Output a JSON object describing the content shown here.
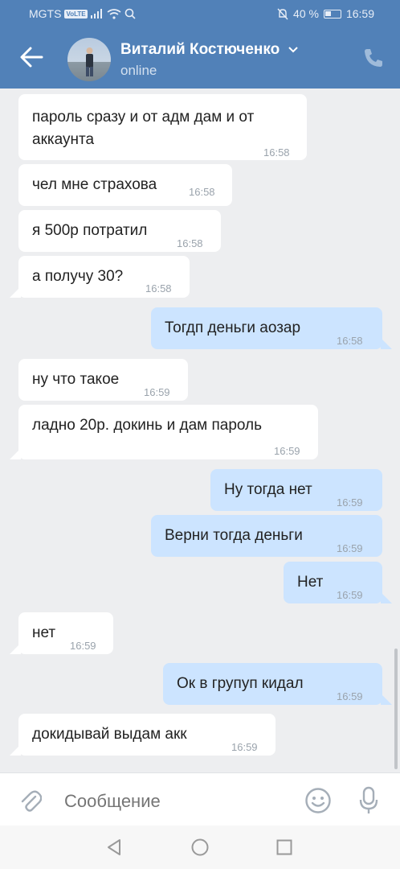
{
  "status_bar": {
    "carrier": "MGTS",
    "volte": "VoLTE",
    "battery": "40 %",
    "time": "16:59"
  },
  "header": {
    "contact_name": "Виталий Костюченко",
    "presence": "online",
    "back_icon": "arrow-left-icon",
    "call_icon": "phone-icon",
    "accent_color": "#5181b8"
  },
  "messages": [
    {
      "dir": "in",
      "lines": [
        "пароль сразу и от адм дам и от",
        "аккаунта"
      ],
      "time": "16:58"
    },
    {
      "dir": "in",
      "lines": [
        "чел мне страхова"
      ],
      "time": "16:58"
    },
    {
      "dir": "in",
      "lines": [
        "я 500р потратил"
      ],
      "time": "16:58"
    },
    {
      "dir": "in",
      "lines": [
        "а получу 30?"
      ],
      "time": "16:58"
    },
    {
      "dir": "out",
      "lines": [
        "Тогдп деньги аозар"
      ],
      "time": "16:58"
    },
    {
      "dir": "in",
      "lines": [
        "ну что такое"
      ],
      "time": "16:59"
    },
    {
      "dir": "in",
      "lines": [
        "ладно 20р. докинь и дам пароль"
      ],
      "time": "16:59"
    },
    {
      "dir": "out",
      "lines": [
        "Ну тогда нет"
      ],
      "time": "16:59"
    },
    {
      "dir": "out",
      "lines": [
        "Верни тогда деньги"
      ],
      "time": "16:59"
    },
    {
      "dir": "out",
      "lines": [
        "Нет"
      ],
      "time": "16:59"
    },
    {
      "dir": "in",
      "lines": [
        "нет"
      ],
      "time": "16:59"
    },
    {
      "dir": "out",
      "lines": [
        "Ок в групуп кидал"
      ],
      "time": "16:59"
    },
    {
      "dir": "in",
      "lines": [
        "докидывай выдам акк"
      ],
      "time": "16:59"
    }
  ],
  "composer": {
    "placeholder": "Сообщение",
    "attach_icon": "paperclip-icon",
    "emoji_icon": "smile-icon",
    "voice_icon": "microphone-icon"
  },
  "colors": {
    "incoming_bubble": "#ffffff",
    "outgoing_bubble": "#cce4ff",
    "chat_background": "#edeef0"
  }
}
